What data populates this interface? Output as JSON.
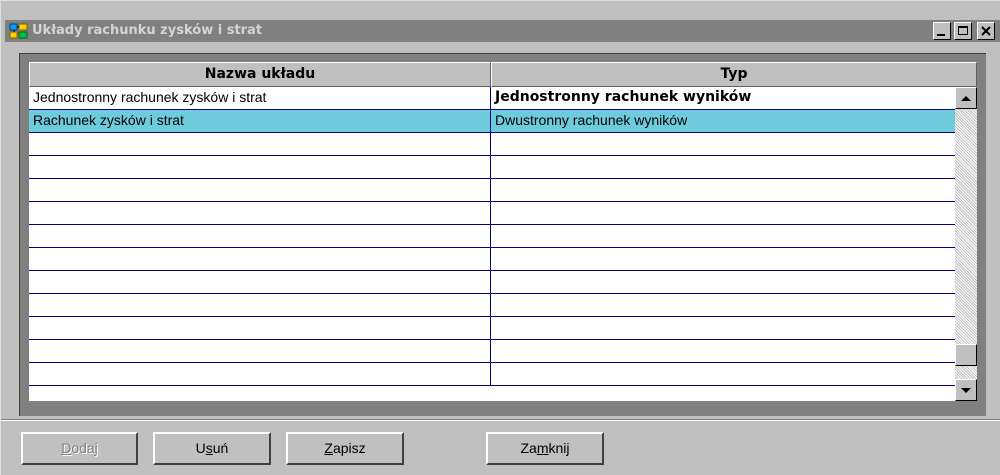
{
  "window": {
    "title": "Układy rachunku zysków i strat",
    "controls": [
      "minimize",
      "maximize",
      "close"
    ]
  },
  "grid": {
    "columns": [
      "Nazwa układu",
      "Typ"
    ],
    "rows": [
      {
        "name": "Jednostronny rachunek zysków i strat",
        "type": "Jednostronny rachunek wyników",
        "bold_type": true,
        "selected": false
      },
      {
        "name": "Rachunek zysków i strat",
        "type": "Dwustronny rachunek wyników",
        "bold_type": false,
        "selected": true
      }
    ],
    "empty_rows": 11,
    "selected_row_color": "#6ecbdc",
    "grid_line_color": "#000080"
  },
  "buttons": {
    "add": {
      "label": "Dodaj",
      "accel": "D",
      "rest": "odaj",
      "enabled": false
    },
    "delete": {
      "pre": "U",
      "accel": "s",
      "rest": "uń",
      "label": "Usuń",
      "enabled": true
    },
    "save": {
      "label": "Zapisz",
      "accel": "Z",
      "rest": "apisz",
      "enabled": true
    },
    "close": {
      "pre": "Za",
      "accel": "m",
      "rest": "knij",
      "label": "Zamknij",
      "enabled": true
    }
  }
}
